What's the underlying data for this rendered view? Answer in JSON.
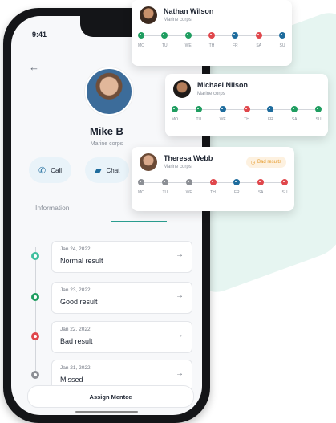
{
  "status_bar": {
    "time": "9:41"
  },
  "profile": {
    "name": "Mike B",
    "role": "Marine corps"
  },
  "actions": {
    "call": "Call",
    "chat": "Chat"
  },
  "tabs": {
    "information": "Information"
  },
  "timeline": [
    {
      "date": "Jan 24, 2022",
      "result": "Normal result",
      "status": "normal",
      "color": "#3fbf9f"
    },
    {
      "date": "Jan 23, 2022",
      "result": "Good result",
      "status": "good",
      "color": "#1f9d60"
    },
    {
      "date": "Jan 22, 2022",
      "result": "Bad result",
      "status": "bad",
      "color": "#e0474c"
    },
    {
      "date": "Jan 21, 2022",
      "result": "Missed",
      "status": "missed",
      "color": "#8c8f95"
    }
  ],
  "assign_button": "Assign Mentee",
  "day_labels": [
    "MO",
    "TU",
    "WE",
    "TH",
    "FR",
    "SA",
    "SU"
  ],
  "colors": {
    "good": "#1f9d60",
    "bad": "#e0474c",
    "info": "#1e6c9d",
    "missed": "#8c8f95",
    "badge": "#e59a2a"
  },
  "mentees": [
    {
      "name": "Nathan Wilson",
      "role": "Marine corps",
      "days": [
        "good",
        "good",
        "good",
        "bad",
        "info",
        "bad",
        "info"
      ]
    },
    {
      "name": "Michael Nilson",
      "role": "Marine corps",
      "days": [
        "good",
        "good",
        "info",
        "bad",
        "info",
        "good",
        "good"
      ]
    },
    {
      "name": "Theresa Webb",
      "role": "Marine corps",
      "badge": "Bad results",
      "days": [
        "missed",
        "missed",
        "missed",
        "bad",
        "info",
        "bad",
        "bad"
      ]
    }
  ]
}
